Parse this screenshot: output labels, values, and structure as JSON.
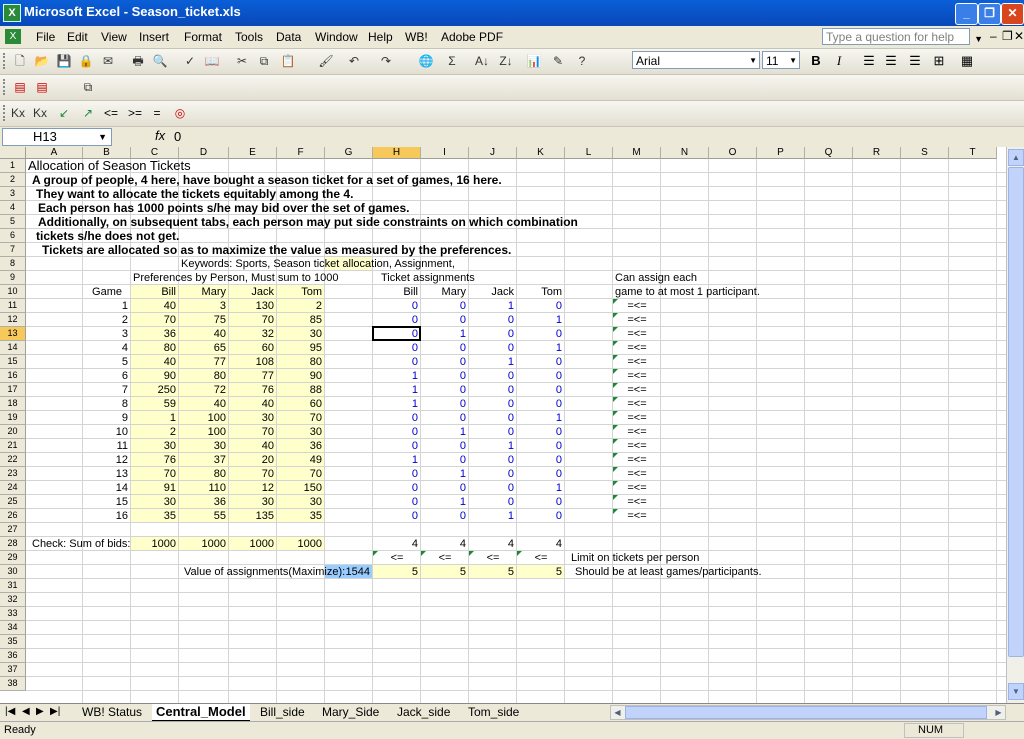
{
  "window": {
    "title": "Microsoft Excel - Season_ticket.xls",
    "app_icon": "X"
  },
  "menu": {
    "items": [
      "File",
      "Edit",
      "View",
      "Insert",
      "Format",
      "Tools",
      "Data",
      "Window",
      "Help",
      "WB!",
      "Adobe PDF"
    ],
    "help_placeholder": "Type a question for help"
  },
  "toolbar": {
    "font": "Arial",
    "size": "11",
    "bold": "B",
    "italic": "I",
    "sigma": "Σ"
  },
  "solver_toolbar": {
    "lte": "<=",
    "gte": ">=",
    "eq": "="
  },
  "formula_bar": {
    "name_box": "H13",
    "fx": "fx",
    "value": "0"
  },
  "columns": [
    "A",
    "B",
    "C",
    "D",
    "E",
    "F",
    "G",
    "H",
    "I",
    "J",
    "K",
    "L",
    "M",
    "N",
    "O",
    "P",
    "Q",
    "R",
    "S",
    "T"
  ],
  "rows": [
    "1",
    "2",
    "3",
    "4",
    "5",
    "6",
    "7",
    "8",
    "9",
    "10",
    "11",
    "12",
    "13",
    "14",
    "15",
    "16",
    "17",
    "18",
    "19",
    "20",
    "21",
    "22",
    "23",
    "24",
    "25",
    "26",
    "27",
    "28",
    "29",
    "30",
    "31",
    "32",
    "33",
    "34",
    "35",
    "36",
    "37",
    "38"
  ],
  "sheet": {
    "title": "Allocation of Season Tickets",
    "desc2": "A group of people, 4 here, have bought a season ticket for a set of games, 16 here.",
    "desc3": "They want to allocate the tickets equitably among the 4.",
    "desc4": "Each person has 1000 points  s/he may bid over the set of games.",
    "desc5": "Additionally, on subsequent tabs, each person may put side constraints on which combination",
    "desc6": "tickets s/he does not get.",
    "desc7": "Tickets are allocated so as to maximize the value as measured by the preferences.",
    "keywords": "Keywords: Sports, Season ticket allocation, Assignment,",
    "pref_header": "Preferences by Person, Must sum to 1000",
    "assign_header": "Ticket  assignments",
    "can_assign1": "Can assign each",
    "can_assign2": "game to at most 1 participant.",
    "game_label": "Game",
    "persons": [
      "Bill",
      "Mary",
      "Jack",
      "Tom"
    ],
    "games": [
      "1",
      "2",
      "3",
      "4",
      "5",
      "6",
      "7",
      "8",
      "9",
      "10",
      "11",
      "12",
      "13",
      "14",
      "15",
      "16"
    ],
    "prefs": [
      [
        "40",
        "3",
        "130",
        "2"
      ],
      [
        "70",
        "75",
        "70",
        "85"
      ],
      [
        "36",
        "40",
        "32",
        "30"
      ],
      [
        "80",
        "65",
        "60",
        "95"
      ],
      [
        "40",
        "77",
        "108",
        "80"
      ],
      [
        "90",
        "80",
        "77",
        "90"
      ],
      [
        "250",
        "72",
        "76",
        "88"
      ],
      [
        "59",
        "40",
        "40",
        "60"
      ],
      [
        "1",
        "100",
        "30",
        "70"
      ],
      [
        "2",
        "100",
        "70",
        "30"
      ],
      [
        "30",
        "30",
        "40",
        "36"
      ],
      [
        "76",
        "37",
        "20",
        "49"
      ],
      [
        "70",
        "80",
        "70",
        "70"
      ],
      [
        "91",
        "110",
        "12",
        "150"
      ],
      [
        "30",
        "36",
        "30",
        "30"
      ],
      [
        "35",
        "55",
        "135",
        "35"
      ]
    ],
    "assign": [
      [
        "0",
        "0",
        "1",
        "0"
      ],
      [
        "0",
        "0",
        "0",
        "1"
      ],
      [
        "0",
        "1",
        "0",
        "0"
      ],
      [
        "0",
        "0",
        "0",
        "1"
      ],
      [
        "0",
        "0",
        "1",
        "0"
      ],
      [
        "1",
        "0",
        "0",
        "0"
      ],
      [
        "1",
        "0",
        "0",
        "0"
      ],
      [
        "1",
        "0",
        "0",
        "0"
      ],
      [
        "0",
        "0",
        "0",
        "1"
      ],
      [
        "0",
        "1",
        "0",
        "0"
      ],
      [
        "0",
        "0",
        "1",
        "0"
      ],
      [
        "1",
        "0",
        "0",
        "0"
      ],
      [
        "0",
        "1",
        "0",
        "0"
      ],
      [
        "0",
        "0",
        "0",
        "1"
      ],
      [
        "0",
        "1",
        "0",
        "0"
      ],
      [
        "0",
        "0",
        "1",
        "0"
      ]
    ],
    "game_constraint": "=<=",
    "check_label": "Check: Sum of bids:",
    "sums": [
      "1000",
      "1000",
      "1000",
      "1000"
    ],
    "assign_totals": [
      "4",
      "4",
      "4",
      "4"
    ],
    "le": "<=",
    "limit_label": "Limit on tickets per person",
    "value_label": "Value of assignments(Maximize):",
    "value": "1544",
    "limits": [
      "5",
      "5",
      "5",
      "5"
    ],
    "atleast_label": "Should be at least games/participants."
  },
  "tabs": [
    "WB! Status",
    "Central_Model",
    "Bill_side",
    "Mary_Side",
    "Jack_side",
    "Tom_side"
  ],
  "status": {
    "left": "Ready",
    "num": "NUM"
  }
}
